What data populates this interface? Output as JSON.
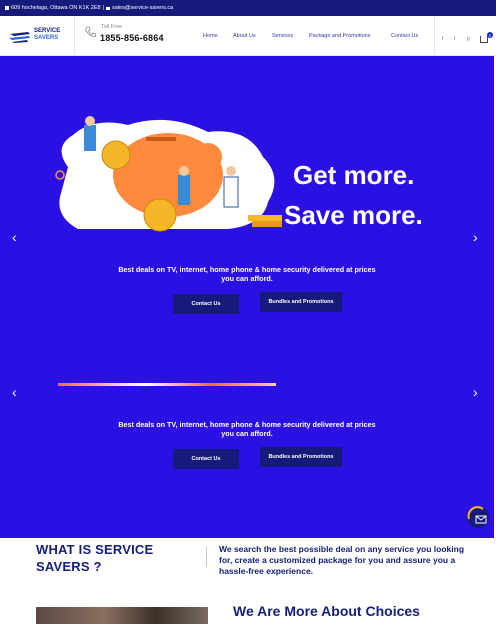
{
  "topbar": {
    "address": "609 hochelaga, Ottawa ON K1K 2E8",
    "separator": "|",
    "email": "sales@service-savers.ca"
  },
  "header": {
    "logo_line1": "SERVICE",
    "logo_line2": "SAVERS",
    "phone_label": "Toll Free",
    "phone_number": "1855-856-6864",
    "nav": [
      "Home",
      "About Us",
      "Services",
      "Package and Promotions",
      "Contact Us"
    ],
    "social_icons": [
      "facebook-icon",
      "twitter-icon",
      "google-plus-icon"
    ],
    "cart_count": "0"
  },
  "hero": {
    "headline_1": "Get more.",
    "headline_2": "Save more.",
    "slides": [
      {
        "subtext": "Best deals on TV, internet, home phone & home security delivered at prices you can afford.",
        "contact_label": "Contact Us",
        "bundles_label": "Bundles and Promotions"
      },
      {
        "subtext": "Best deals on TV, internet, home phone & home security delivered at prices you can afford.",
        "contact_label": "Contact Us",
        "bundles_label": "Bundles and Promotions"
      }
    ],
    "prev_arrow": "‹",
    "next_arrow": "›"
  },
  "about": {
    "title": "WHAT IS SERVICE SAVERS ?",
    "text": "We search the best possible deal on any service you looking for, create a customized package for you and assure you a hassle-free experience."
  },
  "more": {
    "title": "We Are More About Choices"
  },
  "colors": {
    "brand_dark": "#161a7a",
    "hero_blue": "#2b10e3",
    "accent_orange": "#ff8a3d"
  }
}
